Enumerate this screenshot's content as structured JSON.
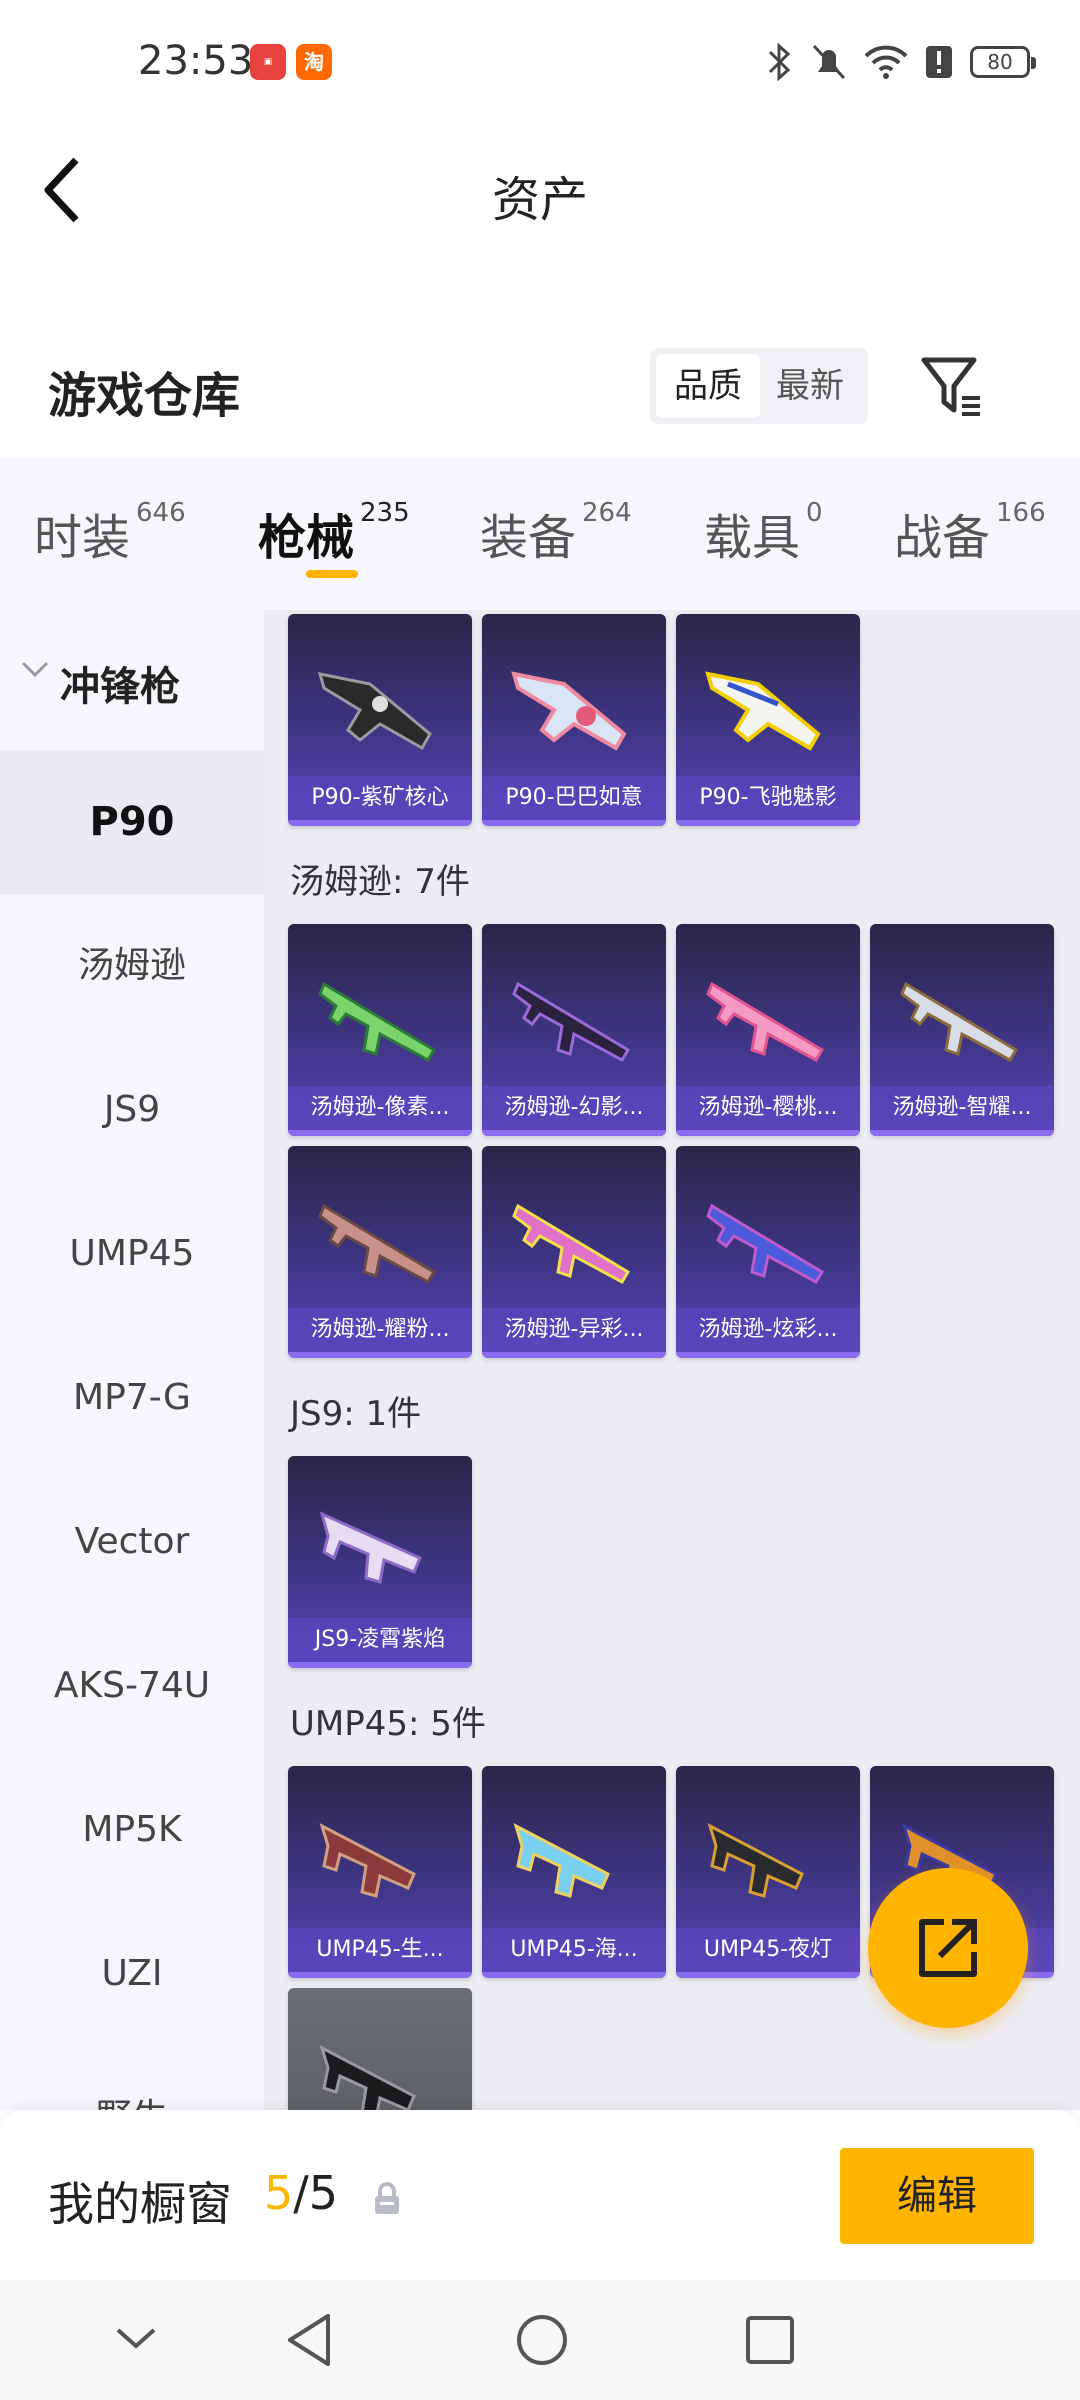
{
  "status_bar": {
    "time": "23:53",
    "apps": [
      "huawei-app-icon",
      "taobao-app-icon"
    ],
    "battery": "80"
  },
  "header": {
    "title": "资产"
  },
  "warehouse": {
    "title": "游戏仓库",
    "sort_options": [
      "品质",
      "最新"
    ],
    "active_sort": "品质"
  },
  "tabs": [
    {
      "label": "时装",
      "count": "646"
    },
    {
      "label": "枪械",
      "count": "235"
    },
    {
      "label": "装备",
      "count": "264"
    },
    {
      "label": "载具",
      "count": "0"
    },
    {
      "label": "战备",
      "count": "166"
    }
  ],
  "active_tab": "枪械",
  "sidebar": {
    "category": "冲锋枪",
    "items": [
      "P90",
      "汤姆逊",
      "JS9",
      "UMP45",
      "MP7-G",
      "Vector",
      "AKS-74U",
      "MP5K",
      "UZI",
      "野牛"
    ],
    "active_item": "P90"
  },
  "groups": [
    {
      "title": "",
      "cards": [
        "P90-紫矿核心",
        "P90-巴巴如意",
        "P90-飞驰魅影"
      ]
    },
    {
      "title": "汤姆逊: 7件",
      "cards": [
        "汤姆逊-像素...",
        "汤姆逊-幻影...",
        "汤姆逊-樱桃...",
        "汤姆逊-智耀...",
        "汤姆逊-耀粉...",
        "汤姆逊-异彩...",
        "汤姆逊-炫彩..."
      ]
    },
    {
      "title": "JS9: 1件",
      "cards": [
        "JS9-凌霄紫焰"
      ]
    },
    {
      "title": "UMP45: 5件",
      "cards": [
        "UMP45-生...",
        "UMP45-海...",
        "UMP45-夜灯",
        ""
      ]
    }
  ],
  "showcase": {
    "label": "我的橱窗",
    "current": "5",
    "separator": "/",
    "total": "5",
    "edit_label": "编辑"
  },
  "colors": {
    "accent": "#ffb400",
    "card_bg": "#3f3585",
    "page_bg": "#ecedf3"
  }
}
